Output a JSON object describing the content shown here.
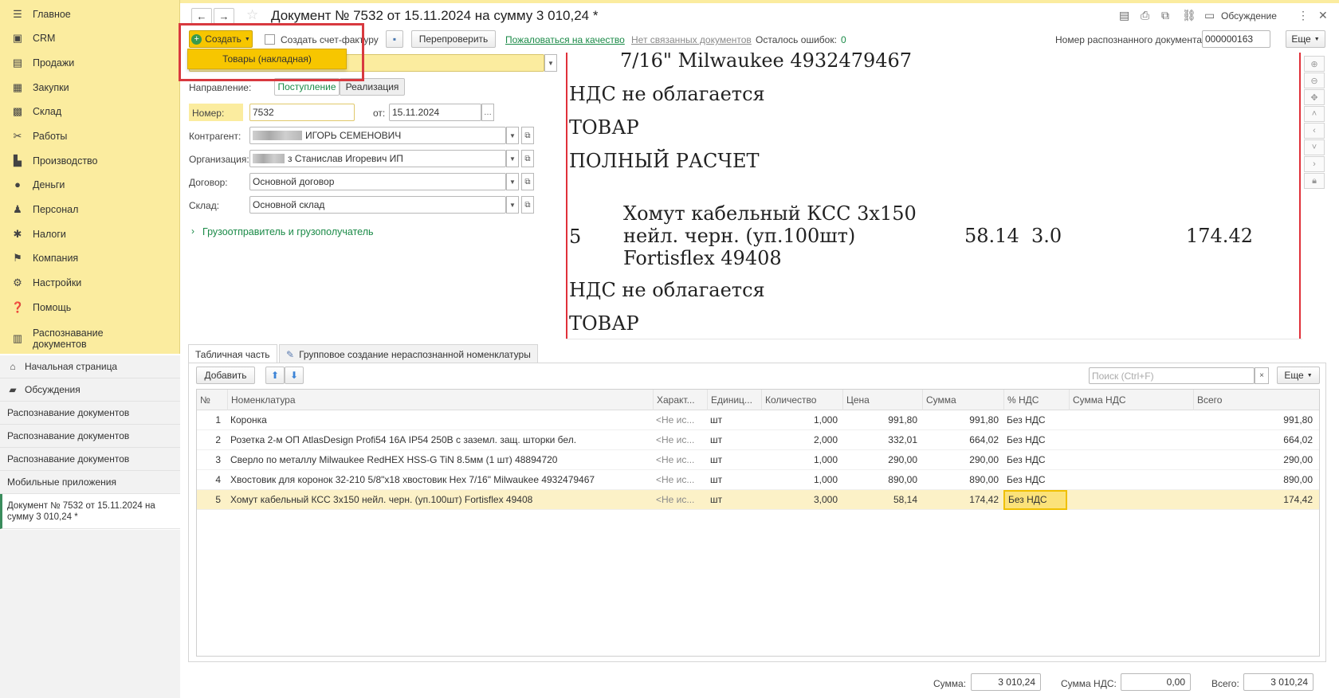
{
  "sidebar": {
    "sections": [
      {
        "label": "Главное",
        "icon": "menu-icon"
      },
      {
        "label": "CRM",
        "icon": "crm-icon"
      },
      {
        "label": "Продажи",
        "icon": "sales-icon"
      },
      {
        "label": "Закупки",
        "icon": "purchases-icon"
      },
      {
        "label": "Склад",
        "icon": "warehouse-icon"
      },
      {
        "label": "Работы",
        "icon": "tools-icon"
      },
      {
        "label": "Производство",
        "icon": "factory-icon"
      },
      {
        "label": "Деньги",
        "icon": "money-icon"
      },
      {
        "label": "Персонал",
        "icon": "people-icon"
      },
      {
        "label": "Налоги",
        "icon": "taxes-icon"
      },
      {
        "label": "Компания",
        "icon": "flag-icon"
      },
      {
        "label": "Настройки",
        "icon": "gear-icon"
      },
      {
        "label": "Помощь",
        "icon": "help-icon"
      },
      {
        "label": "Распознавание документов",
        "icon": "recognition-icon"
      }
    ],
    "open_windows": [
      {
        "label": "Начальная страница",
        "icon": "home-icon"
      },
      {
        "label": "Обсуждения",
        "icon": "chat-icon"
      },
      {
        "label": "Распознавание документов"
      },
      {
        "label": "Распознавание документов"
      },
      {
        "label": "Распознавание документов"
      },
      {
        "label": "Мобильные приложения"
      },
      {
        "label": "Документ № 7532 от 15.11.2024 на сумму 3 010,24 *"
      }
    ]
  },
  "header": {
    "title": "Документ № 7532 от 15.11.2024 на сумму 3 010,24 *",
    "discussion_label": "Обсуждение"
  },
  "toolbar": {
    "create_label": "Создать",
    "create_invoice_label": "Создать счет-фактуру",
    "recheck_label": "Перепроверить",
    "complain_link": "Пожаловаться на качество",
    "no_linked_link": "Нет связанных документов",
    "errors_label": "Осталось ошибок:",
    "errors_value": "0",
    "recognized_label": "Номер распознанного документа:",
    "recognized_value": "000000163",
    "more_label": "Еще"
  },
  "create_menu": {
    "item": "Товары (накладная)"
  },
  "form": {
    "direction_label": "Направление:",
    "direction_in": "Поступление",
    "direction_out": "Реализация",
    "number_label": "Номер:",
    "number_value": "7532",
    "date_label": "от:",
    "date_value": "15.11.2024",
    "contractor_label": "Контрагент:",
    "contractor_value": "ИГОРЬ СЕМЕНОВИЧ",
    "org_label": "Организация:",
    "org_value": "з Станислав Игоревич ИП",
    "contract_label": "Договор:",
    "contract_value": "Основной договор",
    "warehouse_label": "Склад:",
    "warehouse_value": "Основной склад",
    "shipper_link": "Грузоотправитель и грузополучатель"
  },
  "viewer": {
    "line1": "7/16\" Milwaukee 4932479467",
    "line2": "НДС не облагается",
    "line3": "ТОВАР",
    "line4": "ПОЛНЫЙ РАСЧЕТ",
    "item_no": "5",
    "item_name_1": "Хомут кабельный КСС 3х150",
    "item_name_2": "нейл. черн. (уп.100шт)",
    "item_name_3": "Fortisflex 49408",
    "item_price": "58.14",
    "item_qty": "3.0",
    "item_total": "174.42",
    "line5": "НДС не облагается",
    "line6": "ТОВАР"
  },
  "tabs": {
    "table_part": "Табличная часть",
    "group_create": "Групповое создание нераспознанной номенклатуры"
  },
  "table_toolbar": {
    "add_label": "Добавить",
    "search_placeholder": "Поиск (Ctrl+F)",
    "more_label": "Еще"
  },
  "table": {
    "headers": {
      "num": "№",
      "name": "Номенклатура",
      "char": "Характ...",
      "unit": "Единиц...",
      "qty": "Количество",
      "price": "Цена",
      "sum": "Сумма",
      "vat_rate": "% НДС",
      "vat_sum": "Сумма НДС",
      "total": "Всего"
    },
    "rows": [
      {
        "num": "1",
        "name": "Коронка",
        "char": "<Не ис...",
        "unit": "шт",
        "qty": "1,000",
        "price": "991,80",
        "sum": "991,80",
        "vat_rate": "Без НДС",
        "vat_sum": "",
        "total": "991,80"
      },
      {
        "num": "2",
        "name": "Розетка 2-м ОП AtlasDesign Profi54 16А IP54 250В с заземл. защ. шторки бел.",
        "char": "<Не ис...",
        "unit": "шт",
        "qty": "2,000",
        "price": "332,01",
        "sum": "664,02",
        "vat_rate": "Без НДС",
        "vat_sum": "",
        "total": "664,02"
      },
      {
        "num": "3",
        "name": "Сверло по металлу Milwaukee RedHEX HSS-G TiN 8.5мм (1 шт) 48894720",
        "char": "<Не ис...",
        "unit": "шт",
        "qty": "1,000",
        "price": "290,00",
        "sum": "290,00",
        "vat_rate": "Без НДС",
        "vat_sum": "",
        "total": "290,00"
      },
      {
        "num": "4",
        "name": "Хвостовик для коронок 32-210 5/8\"х18 хвостовик Hex 7/16\" Milwaukee 4932479467",
        "char": "<Не ис...",
        "unit": "шт",
        "qty": "1,000",
        "price": "890,00",
        "sum": "890,00",
        "vat_rate": "Без НДС",
        "vat_sum": "",
        "total": "890,00"
      },
      {
        "num": "5",
        "name": "Хомут кабельный КСС 3х150 нейл. черн. (уп.100шт) Fortisflex 49408",
        "char": "<Не ис...",
        "unit": "шт",
        "qty": "3,000",
        "price": "58,14",
        "sum": "174,42",
        "vat_rate": "Без НДС",
        "vat_sum": "",
        "total": "174,42"
      }
    ]
  },
  "footer": {
    "sum_label": "Сумма:",
    "sum_value": "3 010,24",
    "vat_label": "Сумма НДС:",
    "vat_value": "0,00",
    "total_label": "Всего:",
    "total_value": "3 010,24"
  },
  "colors": {
    "sidebar_bg": "#fbec9f",
    "accent_green": "#3a8c5c",
    "create_button": "#f7c600",
    "highlight_red": "#d8393f"
  }
}
